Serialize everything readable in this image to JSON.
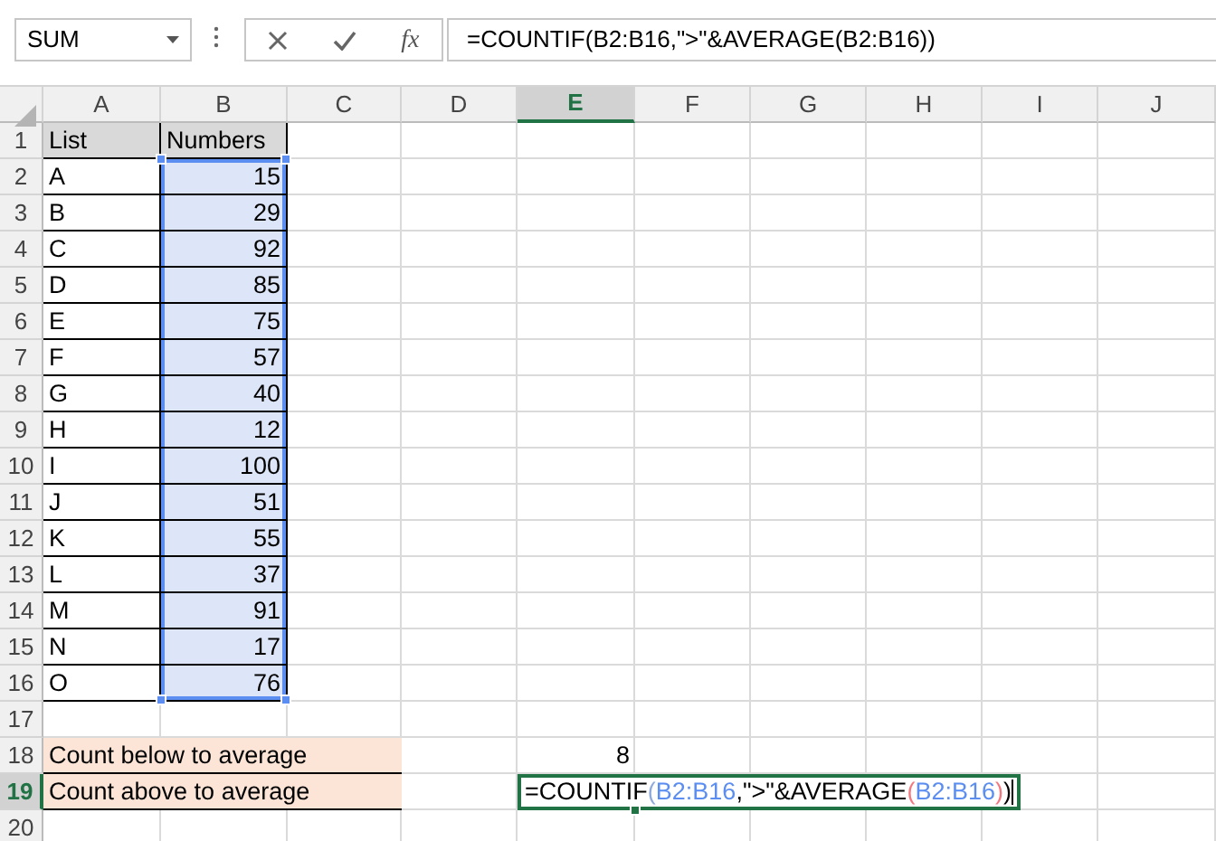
{
  "formula_bar": {
    "name_box": "SUM",
    "function_label": "fx",
    "formula": "=COUNTIF(B2:B16,\">\"&AVERAGE(B2:B16))"
  },
  "columns": [
    {
      "label": "A",
      "selected": false
    },
    {
      "label": "B",
      "selected": false
    },
    {
      "label": "C",
      "selected": false
    },
    {
      "label": "D",
      "selected": false
    },
    {
      "label": "E",
      "selected": true
    },
    {
      "label": "F",
      "selected": false
    },
    {
      "label": "G",
      "selected": false
    },
    {
      "label": "H",
      "selected": false
    },
    {
      "label": "I",
      "selected": false
    },
    {
      "label": "J",
      "selected": false
    }
  ],
  "rows": [
    {
      "number": "1",
      "selected": false,
      "kind": "header",
      "A": "List",
      "B": "Numbers"
    },
    {
      "number": "2",
      "selected": false,
      "kind": "data",
      "A": "A",
      "B": "15",
      "in_selection": true
    },
    {
      "number": "3",
      "selected": false,
      "kind": "data",
      "A": "B",
      "B": "29",
      "in_selection": true
    },
    {
      "number": "4",
      "selected": false,
      "kind": "data",
      "A": "C",
      "B": "92",
      "in_selection": true
    },
    {
      "number": "5",
      "selected": false,
      "kind": "data",
      "A": "D",
      "B": "85",
      "in_selection": true
    },
    {
      "number": "6",
      "selected": false,
      "kind": "data",
      "A": "E",
      "B": "75",
      "in_selection": true
    },
    {
      "number": "7",
      "selected": false,
      "kind": "data",
      "A": "F",
      "B": "57",
      "in_selection": true
    },
    {
      "number": "8",
      "selected": false,
      "kind": "data",
      "A": "G",
      "B": "40",
      "in_selection": true
    },
    {
      "number": "9",
      "selected": false,
      "kind": "data",
      "A": "H",
      "B": "12",
      "in_selection": true
    },
    {
      "number": "10",
      "selected": false,
      "kind": "data",
      "A": "I",
      "B": "100",
      "in_selection": true
    },
    {
      "number": "11",
      "selected": false,
      "kind": "data",
      "A": "J",
      "B": "51",
      "in_selection": true
    },
    {
      "number": "12",
      "selected": false,
      "kind": "data",
      "A": "K",
      "B": "55",
      "in_selection": true
    },
    {
      "number": "13",
      "selected": false,
      "kind": "data",
      "A": "L",
      "B": "37",
      "in_selection": true
    },
    {
      "number": "14",
      "selected": false,
      "kind": "data",
      "A": "M",
      "B": "91",
      "in_selection": true
    },
    {
      "number": "15",
      "selected": false,
      "kind": "data",
      "A": "N",
      "B": "17",
      "in_selection": true
    },
    {
      "number": "16",
      "selected": false,
      "kind": "data",
      "A": "O",
      "B": "76",
      "in_selection": true
    },
    {
      "number": "17",
      "selected": false,
      "kind": "blank"
    },
    {
      "number": "18",
      "selected": false,
      "kind": "summary",
      "A": "Count below to average",
      "E": "8"
    },
    {
      "number": "19",
      "selected": true,
      "kind": "summary",
      "A": "Count above to average",
      "editing": [
        {
          "text": "=COUNTIF",
          "color": "#000000"
        },
        {
          "text": "(",
          "color": "#8ea9db"
        },
        {
          "text": "B2:B16",
          "color": "#5b8ef0"
        },
        {
          "text": ",\">\"&AVERAGE",
          "color": "#000000"
        },
        {
          "text": "(",
          "color": "#f4777f"
        },
        {
          "text": "B2:B16",
          "color": "#5b8ef0"
        },
        {
          "text": ")",
          "color": "#f4777f"
        },
        {
          "text": ")",
          "color": "#000000"
        }
      ]
    },
    {
      "number": "20",
      "selected": false,
      "kind": "blank"
    }
  ]
}
